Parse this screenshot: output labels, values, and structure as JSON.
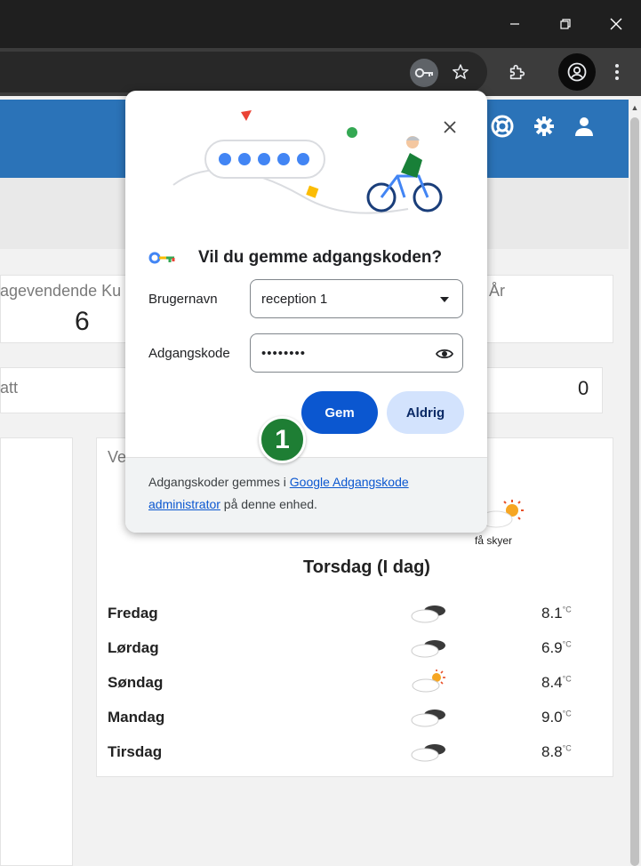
{
  "browser": {
    "window_controls": {
      "minimize": "—",
      "maximize": "❐",
      "close": "✕"
    },
    "toolbar_icons": [
      "key-icon",
      "star-icon",
      "extensions-icon",
      "profile-icon",
      "more-vert-icon"
    ]
  },
  "app": {
    "stats": {
      "card1_label": "agevendende Ku",
      "card1_value": "6",
      "card2_label": "År",
      "card3_label": "att",
      "card3_value": "0"
    },
    "weather": {
      "title_partial": "Ve",
      "current_desc": "få skyer",
      "today_label": "Torsdag (I dag)",
      "days": [
        {
          "day": "Fredag",
          "icon": "cloudy-icon",
          "temp": "8.1",
          "unit": "°C"
        },
        {
          "day": "Lørdag",
          "icon": "cloudy-icon",
          "temp": "6.9",
          "unit": "°C"
        },
        {
          "day": "Søndag",
          "icon": "partly-sunny-icon",
          "temp": "8.4",
          "unit": "°C"
        },
        {
          "day": "Mandag",
          "icon": "cloudy-icon",
          "temp": "9.0",
          "unit": "°C"
        },
        {
          "day": "Tirsdag",
          "icon": "cloudy-icon",
          "temp": "8.8",
          "unit": "°C"
        }
      ]
    }
  },
  "popup": {
    "title": "Vil du gemme adgangskoden?",
    "username_label": "Brugernavn",
    "username_value": "reception 1",
    "password_label": "Adgangskode",
    "password_value": "••••••••",
    "save_button": "Gem",
    "never_button": "Aldrig",
    "footer_prefix": "Adgangskoder gemmes i ",
    "footer_link": "Google Adgangskode administrator",
    "footer_suffix": " på denne enhed."
  },
  "annotation": {
    "step_number": "1",
    "color": "#1e7e34"
  },
  "colors": {
    "app_bar": "#2b73b8",
    "primary_button": "#0b57d0",
    "tonal_button": "#d3e3fd"
  }
}
